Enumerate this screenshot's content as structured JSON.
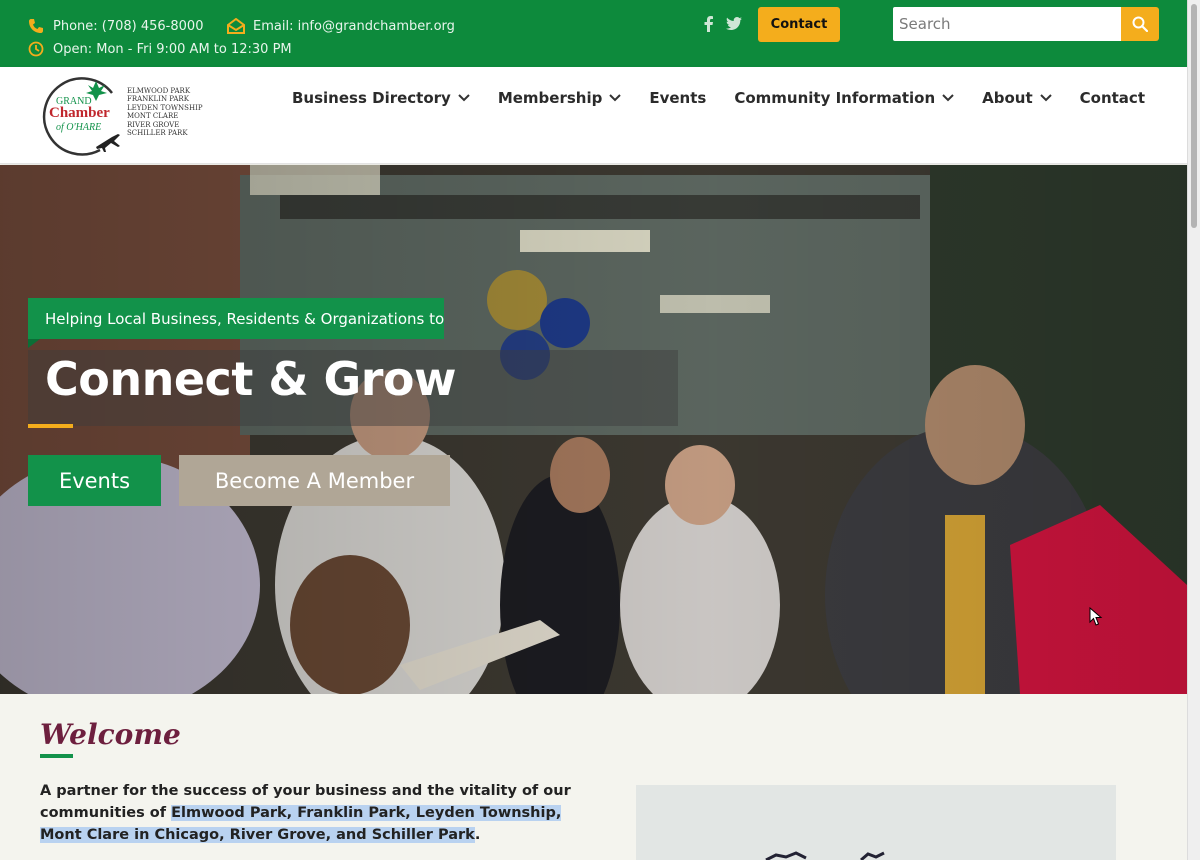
{
  "topbar": {
    "phone": "Phone: (708) 456-8000",
    "email": "Email: info@grandchamber.org",
    "hours": "Open: Mon - Fri 9:00 AM to 12:30 PM",
    "contact_button": "Contact",
    "search_placeholder": "Search",
    "social": [
      "facebook-icon",
      "twitter-icon"
    ]
  },
  "logo": {
    "line1": "GRAND",
    "line2": "Chamber",
    "line3": "of O'HARE",
    "towns": [
      "ELMWOOD PARK",
      "FRANKLIN PARK",
      "LEYDEN TOWNSHIP",
      "MONT CLARE",
      "RIVER GROVE",
      "SCHILLER PARK"
    ]
  },
  "nav": {
    "items": [
      {
        "label": "Business Directory",
        "dropdown": true
      },
      {
        "label": "Membership",
        "dropdown": true
      },
      {
        "label": "Events",
        "dropdown": false
      },
      {
        "label": "Community Information",
        "dropdown": true
      },
      {
        "label": "About",
        "dropdown": true
      },
      {
        "label": "Contact",
        "dropdown": false
      }
    ]
  },
  "hero": {
    "eyebrow": "Helping Local Business, Residents & Organizations to",
    "headline": "Connect & Grow",
    "events_button": "Events",
    "member_button": "Become A Member"
  },
  "welcome": {
    "title": "Welcome",
    "text_intro": "A partner for the success of your business and the vitality of our communities of ",
    "text_highlight": "Elmwood Park, Franklin Park, Leyden Township, Mont Clare in Chicago, River Grove, and Schiller Park",
    "text_end": "."
  },
  "colors": {
    "brand_green": "#0d8a3c",
    "accent_gold": "#f4ad1c",
    "maroon": "#6d1f3e",
    "member_tan": "#b0a696"
  }
}
